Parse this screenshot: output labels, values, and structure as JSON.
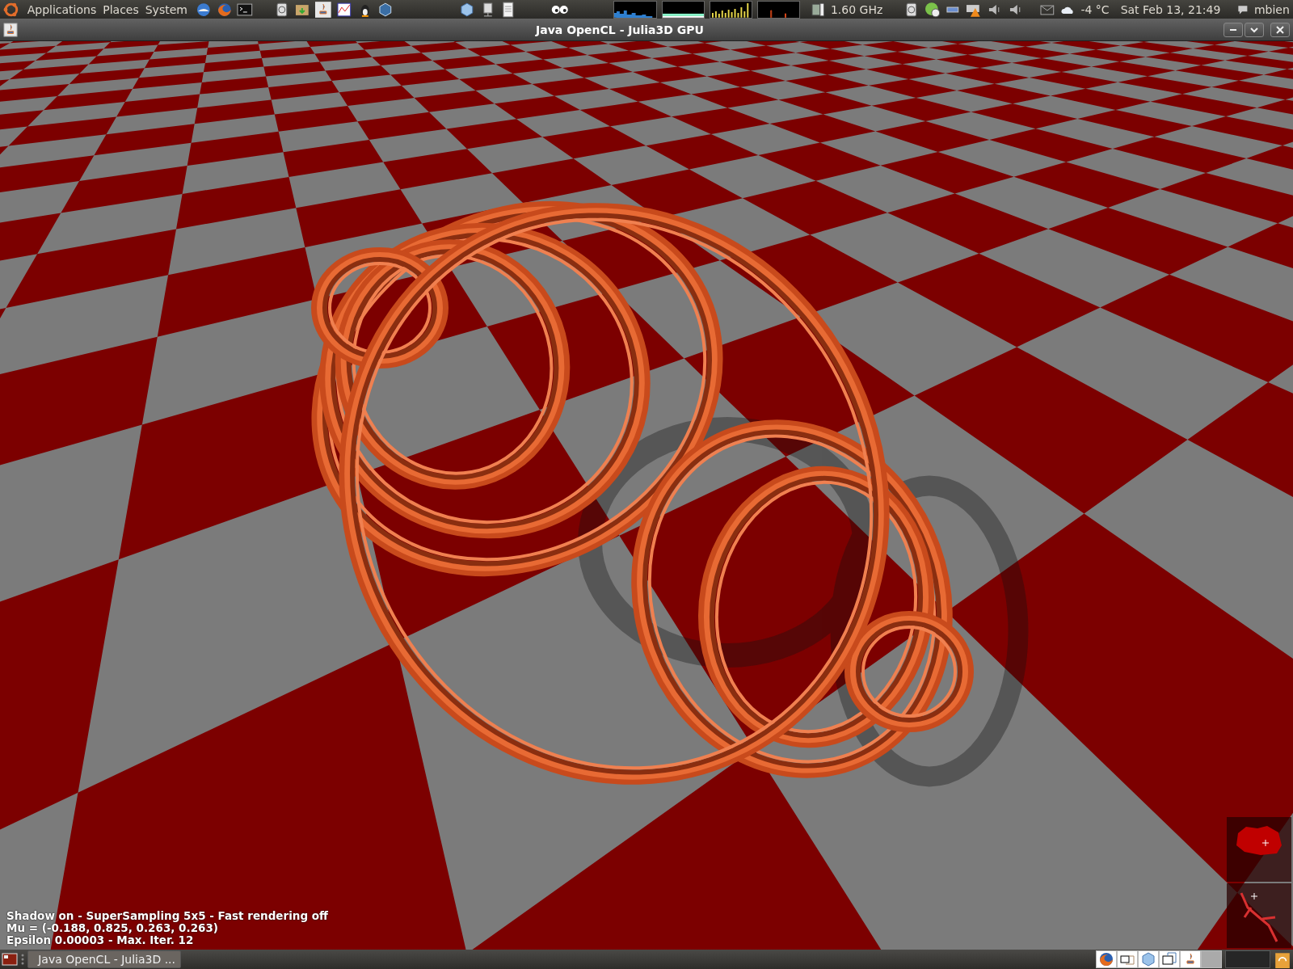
{
  "top_panel": {
    "menus": [
      "Applications",
      "Places",
      "System"
    ],
    "cpu_frequency": "1.60 GHz",
    "weather": "-4 °C",
    "clock": "Sat Feb 13, 21:49",
    "user": "mbien"
  },
  "window": {
    "title": "Java OpenCL - Julia3D GPU"
  },
  "render": {
    "status_lines": [
      "Shadow on - SuperSampling 5x5 - Fast rendering off",
      "Mu = (-0.188, 0.825, 0.263, 0.263)",
      "Epsilon 0.00003 - Max. Iter. 12"
    ]
  },
  "taskbar": {
    "tasks": [
      {
        "label": "Java OpenCL - Julia3D ...",
        "selected": true
      }
    ]
  }
}
